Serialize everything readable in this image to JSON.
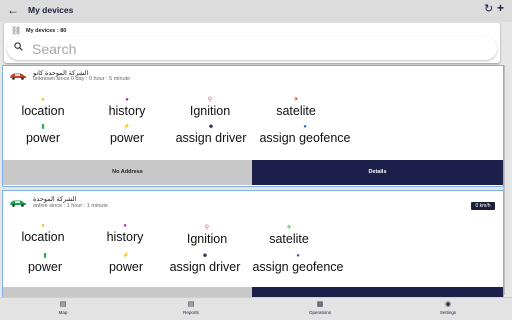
{
  "header": {
    "title": "My devices",
    "back_icon": "arrow-left-icon",
    "refresh_icon": "refresh-icon",
    "add_icon": "plus-icon"
  },
  "search": {
    "count_label": "My devices : 80",
    "placeholder": "Search"
  },
  "devices": [
    {
      "name": "الشركة الموحدة كانو",
      "status": "unknown  since 0 day : 0 hour : 5 minute",
      "car_color": "#c0442a",
      "speed": "",
      "features_row1": [
        "location",
        "history",
        "Ignition",
        "satelite"
      ],
      "features_row2": [
        "power",
        "power",
        "assign driver",
        "assign geofence"
      ],
      "left_button": "No Address",
      "right_button": "Details"
    },
    {
      "name": "الشركة الموحدة",
      "status": "online  since : 1 hour : 1 minute",
      "car_color": "#1aa34a",
      "speed": "0 km/h",
      "features_row1": [
        "location",
        "history",
        "Ignition",
        "satelite"
      ],
      "features_row2": [
        "power",
        "power",
        "assign driver",
        "assign geofence"
      ],
      "left_button": "",
      "right_button": ""
    }
  ],
  "bottom_nav": [
    {
      "label": "Map",
      "icon": "map-icon"
    },
    {
      "label": "Reports",
      "icon": "reports-icon"
    },
    {
      "label": "Operations",
      "icon": "grid-icon"
    },
    {
      "label": "Settings",
      "icon": "settings-icon"
    }
  ],
  "colors": {
    "primary": "#1c1f4a",
    "card_border": "#7fb2e6",
    "muted_button": "#c8c8c8"
  }
}
